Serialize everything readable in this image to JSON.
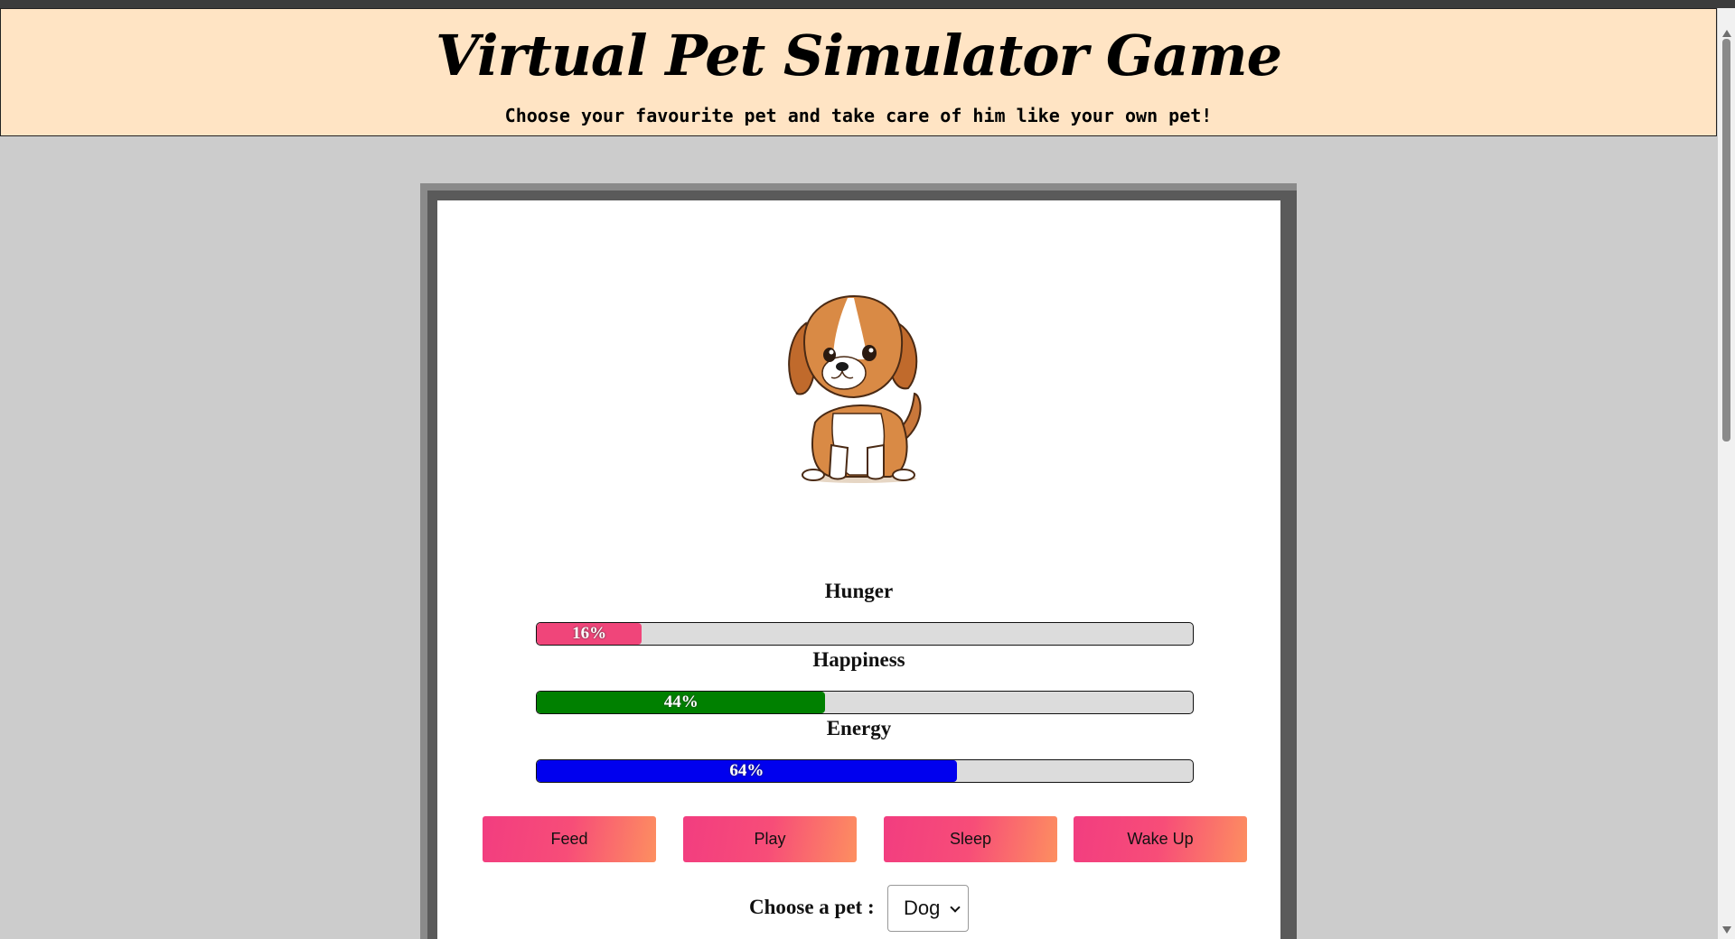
{
  "header": {
    "title": "Virtual Pet Simulator Game",
    "subtitle": "Choose your favourite pet and take care of him like your own pet!"
  },
  "pet": {
    "image_icon": "puppy-icon"
  },
  "stats": {
    "hunger": {
      "label": "Hunger",
      "value_text": "16%",
      "value": 16,
      "color": "#f0457a"
    },
    "happiness": {
      "label": "Happiness",
      "value_text": "44%",
      "value": 44,
      "color": "#008000"
    },
    "energy": {
      "label": "Energy",
      "value_text": "64%",
      "value": 64,
      "color": "#0000ee"
    }
  },
  "actions": {
    "feed": "Feed",
    "play": "Play",
    "sleep": "Sleep",
    "wake_up": "Wake Up"
  },
  "pet_select": {
    "label": "Choose a pet :",
    "selected": "Dog"
  },
  "colors": {
    "header_bg": "#ffe4c4",
    "page_bg": "#cccccc",
    "button_gradient_start": "#f23d80",
    "button_gradient_end": "#fd8f60"
  }
}
